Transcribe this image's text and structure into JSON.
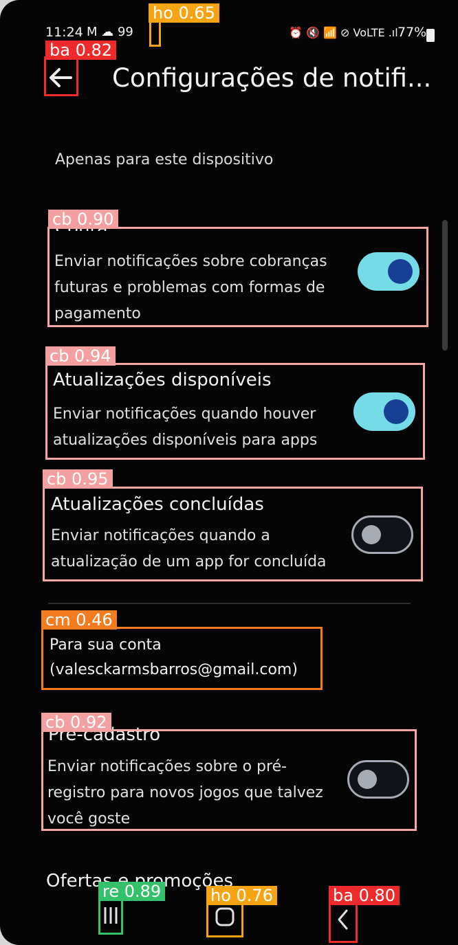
{
  "status_bar": {
    "time": "11:24",
    "left_icons": "M ☁ 99",
    "right_icons": "⏰ 🔇 📶 ⊘ VoLTE .ıl",
    "battery": "77%"
  },
  "header": {
    "title": "Configurações de notifi..."
  },
  "device_section": {
    "label": "Apenas para este dispositivo"
  },
  "settings": {
    "conta": {
      "title": "Conta",
      "description": "Enviar notificações sobre cobranças futuras e problemas com formas de pagamento",
      "enabled": true
    },
    "atualizacoes_disponiveis": {
      "title": "Atualizações disponíveis",
      "description": "Enviar notificações quando houver atualizações disponíveis para apps",
      "enabled": true
    },
    "atualizacoes_concluidas": {
      "title": "Atualizações concluídas",
      "description": "Enviar notificações quando a atualização de um app for concluída",
      "enabled": false
    },
    "pre_cadastro": {
      "title": "Pré-cadastro",
      "description": "Enviar notificações sobre o pré-registro para novos jogos que talvez você goste",
      "enabled": false
    }
  },
  "account_section": {
    "line1": "Para sua conta",
    "line2": "(valesckarmsbarros@gmail.com)"
  },
  "next_section": {
    "title": "Ofertas e promoções"
  },
  "annotations": {
    "ho_top": "ho 0.65",
    "ba_top": "ba 0.82",
    "cb1": "cb 0.90",
    "cb2": "cb 0.94",
    "cb3": "cb 0.95",
    "cm": "cm 0.46",
    "cb4": "cb 0.92",
    "re": "re 0.89",
    "ho_bottom": "ho 0.76",
    "ba_bottom": "ba 0.80"
  },
  "colors": {
    "background": "#050505",
    "toggle_on": "#75dce7",
    "toggle_knob_on": "#173f94",
    "annotation_pink": "#f4a0a0",
    "annotation_red": "#ef2a2a",
    "annotation_orange": "#f47c20",
    "annotation_yellow": "#f6a413",
    "annotation_green": "#34c16a"
  }
}
